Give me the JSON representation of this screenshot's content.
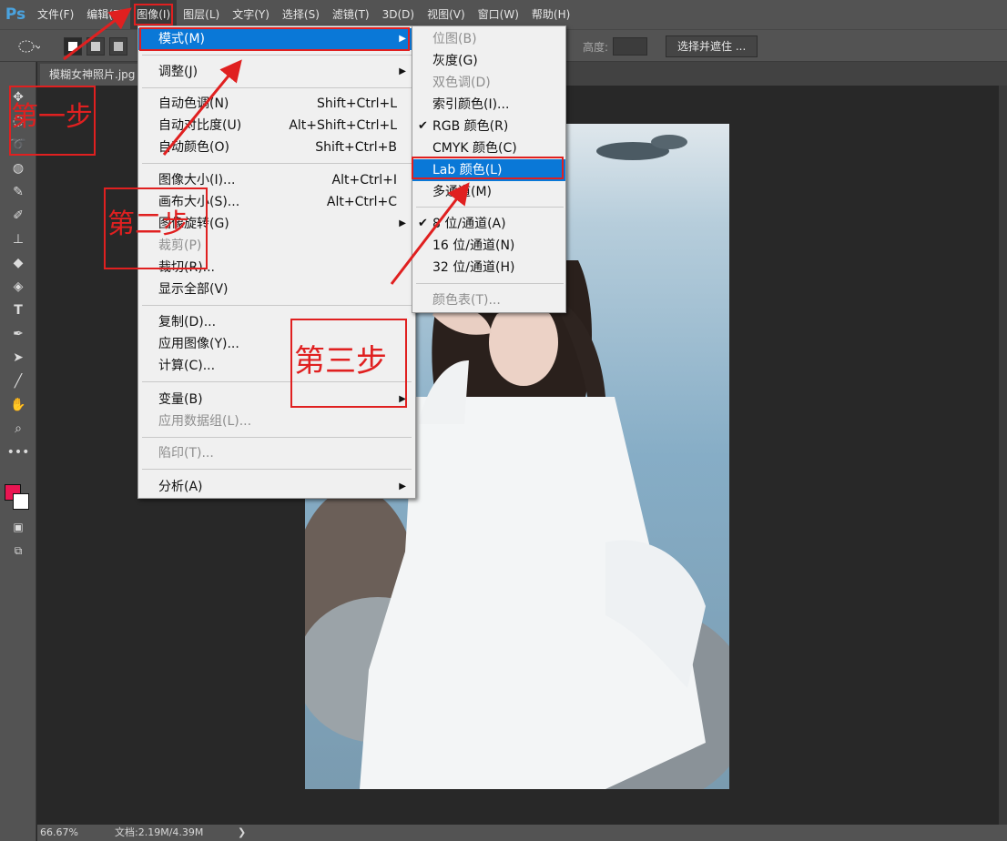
{
  "app": {
    "logo": "Ps"
  },
  "menubar": {
    "items": [
      {
        "label": "文件(F)"
      },
      {
        "label": "编辑(E)"
      },
      {
        "label": "图像(I)"
      },
      {
        "label": "图层(L)"
      },
      {
        "label": "文字(Y)"
      },
      {
        "label": "选择(S)"
      },
      {
        "label": "滤镜(T)"
      },
      {
        "label": "3D(D)"
      },
      {
        "label": "视图(V)"
      },
      {
        "label": "窗口(W)"
      },
      {
        "label": "帮助(H)"
      }
    ]
  },
  "options": {
    "height_label": "高度:",
    "select_mask_label": "选择并遮住 ..."
  },
  "document": {
    "tab_title": "模糊女神照片.jpg"
  },
  "status": {
    "zoom": "66.67%",
    "doc_info": "文档:2.19M/4.39M",
    "arrow": "❯"
  },
  "image_menu": {
    "items": [
      {
        "label": "模式(M)",
        "shortcut": "",
        "submenu": true
      },
      {
        "label": "调整(J)",
        "shortcut": "",
        "submenu": true
      },
      {
        "label": "自动色调(N)",
        "shortcut": "Shift+Ctrl+L"
      },
      {
        "label": "自动对比度(U)",
        "shortcut": "Alt+Shift+Ctrl+L"
      },
      {
        "label": "自动颜色(O)",
        "shortcut": "Shift+Ctrl+B"
      },
      {
        "label": "图像大小(I)...",
        "shortcut": "Alt+Ctrl+I"
      },
      {
        "label": "画布大小(S)...",
        "shortcut": "Alt+Ctrl+C"
      },
      {
        "label": "图像旋转(G)",
        "shortcut": "",
        "submenu": true
      },
      {
        "label": "裁剪(P)",
        "shortcut": "",
        "disabled": true
      },
      {
        "label": "裁切(R)...",
        "shortcut": ""
      },
      {
        "label": "显示全部(V)",
        "shortcut": ""
      },
      {
        "label": "复制(D)...",
        "shortcut": ""
      },
      {
        "label": "应用图像(Y)...",
        "shortcut": ""
      },
      {
        "label": "计算(C)...",
        "shortcut": ""
      },
      {
        "label": "变量(B)",
        "shortcut": "",
        "submenu": true
      },
      {
        "label": "应用数据组(L)...",
        "shortcut": "",
        "disabled": true
      },
      {
        "label": "陷印(T)...",
        "shortcut": "",
        "disabled": true
      },
      {
        "label": "分析(A)",
        "shortcut": "",
        "submenu": true
      }
    ]
  },
  "mode_submenu": {
    "items": [
      {
        "label": "位图(B)",
        "disabled": true
      },
      {
        "label": "灰度(G)"
      },
      {
        "label": "双色调(D)",
        "disabled": true
      },
      {
        "label": "索引颜色(I)..."
      },
      {
        "label": "RGB 颜色(R)",
        "checked": true
      },
      {
        "label": "CMYK 颜色(C)"
      },
      {
        "label": "Lab 颜色(L)",
        "highlighted": true
      },
      {
        "label": "多通道(M)"
      },
      {
        "label": "8 位/通道(A)",
        "checked": true
      },
      {
        "label": "16 位/通道(N)"
      },
      {
        "label": "32 位/通道(H)"
      },
      {
        "label": "颜色表(T)...",
        "disabled": true
      }
    ],
    "check_glyph": "✔"
  },
  "annotations": {
    "step1": "第一步",
    "step2": "第二步",
    "step3": "第三步"
  },
  "colors": {
    "annotation_red": "#e02020",
    "highlight_blue": "#0a78d7",
    "foreground": "#ea1552",
    "background": "#ffffff"
  },
  "icons": {
    "move": "move-icon",
    "marquee": "marquee-icon",
    "lasso": "lasso-icon",
    "quick_select": "quick-select-icon",
    "eyedropper": "eyedropper-icon",
    "brush": "brush-icon",
    "stamp": "stamp-icon",
    "eraser": "eraser-icon",
    "bucket": "bucket-icon",
    "type": "type-icon",
    "pen": "pen-icon",
    "path_select": "path-select-icon",
    "line": "line-icon",
    "hand": "hand-icon",
    "zoom": "zoom-icon",
    "more": "more-icon"
  }
}
